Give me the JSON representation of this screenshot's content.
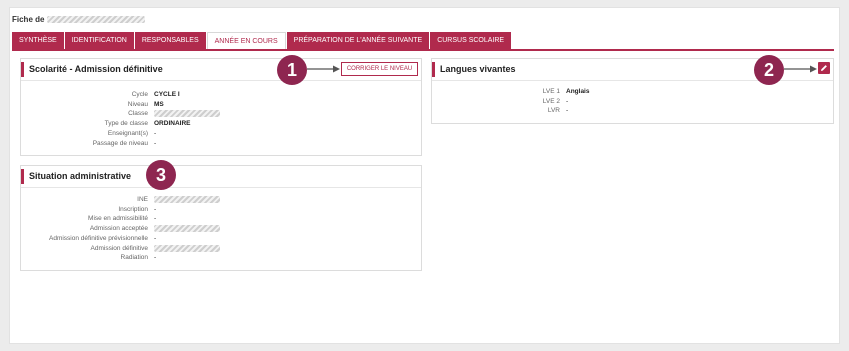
{
  "page": {
    "title_prefix": "Fiche de"
  },
  "tabs": [
    {
      "label": "SYNTHÈSE"
    },
    {
      "label": "IDENTIFICATION"
    },
    {
      "label": "RESPONSABLES"
    },
    {
      "label": "ANNÉE EN COURS"
    },
    {
      "label": "PRÉPARATION DE L'ANNÉE SUIVANTE"
    },
    {
      "label": "CURSUS SCOLAIRE"
    }
  ],
  "active_tab": "ANNÉE EN COURS",
  "scolarite": {
    "title": "Scolarité - Admission définitive",
    "button_label": "CORRIGER LE NIVEAU",
    "rows": [
      {
        "label": "Cycle",
        "value": "CYCLE I"
      },
      {
        "label": "Niveau",
        "value": "MS"
      },
      {
        "label": "Classe",
        "value": ""
      },
      {
        "label": "Type de classe",
        "value": "ORDINAIRE"
      },
      {
        "label": "Enseignant(s)",
        "value": "-"
      },
      {
        "label": "Passage de niveau",
        "value": "-"
      }
    ]
  },
  "situation": {
    "title": "Situation administrative",
    "rows": [
      {
        "label": "INE",
        "value": ""
      },
      {
        "label": "Inscription",
        "value": "-"
      },
      {
        "label": "Mise en admissibilité",
        "value": "-"
      },
      {
        "label": "Admission acceptée",
        "value": ""
      },
      {
        "label": "Admission définitive prévisionnelle",
        "value": "-"
      },
      {
        "label": "Admission définitive",
        "value": ""
      },
      {
        "label": "Radiation",
        "value": "-"
      }
    ]
  },
  "langues": {
    "title": "Langues vivantes",
    "rows": [
      {
        "label": "LVE 1",
        "value": "Anglais"
      },
      {
        "label": "LVE 2",
        "value": "-"
      },
      {
        "label": "LVR",
        "value": "-"
      }
    ]
  },
  "callouts": [
    "1",
    "2",
    "3"
  ],
  "colors": {
    "accent": "#b02a4d",
    "badge": "#8e2650"
  },
  "icons": {
    "edit": "pencil-icon"
  }
}
